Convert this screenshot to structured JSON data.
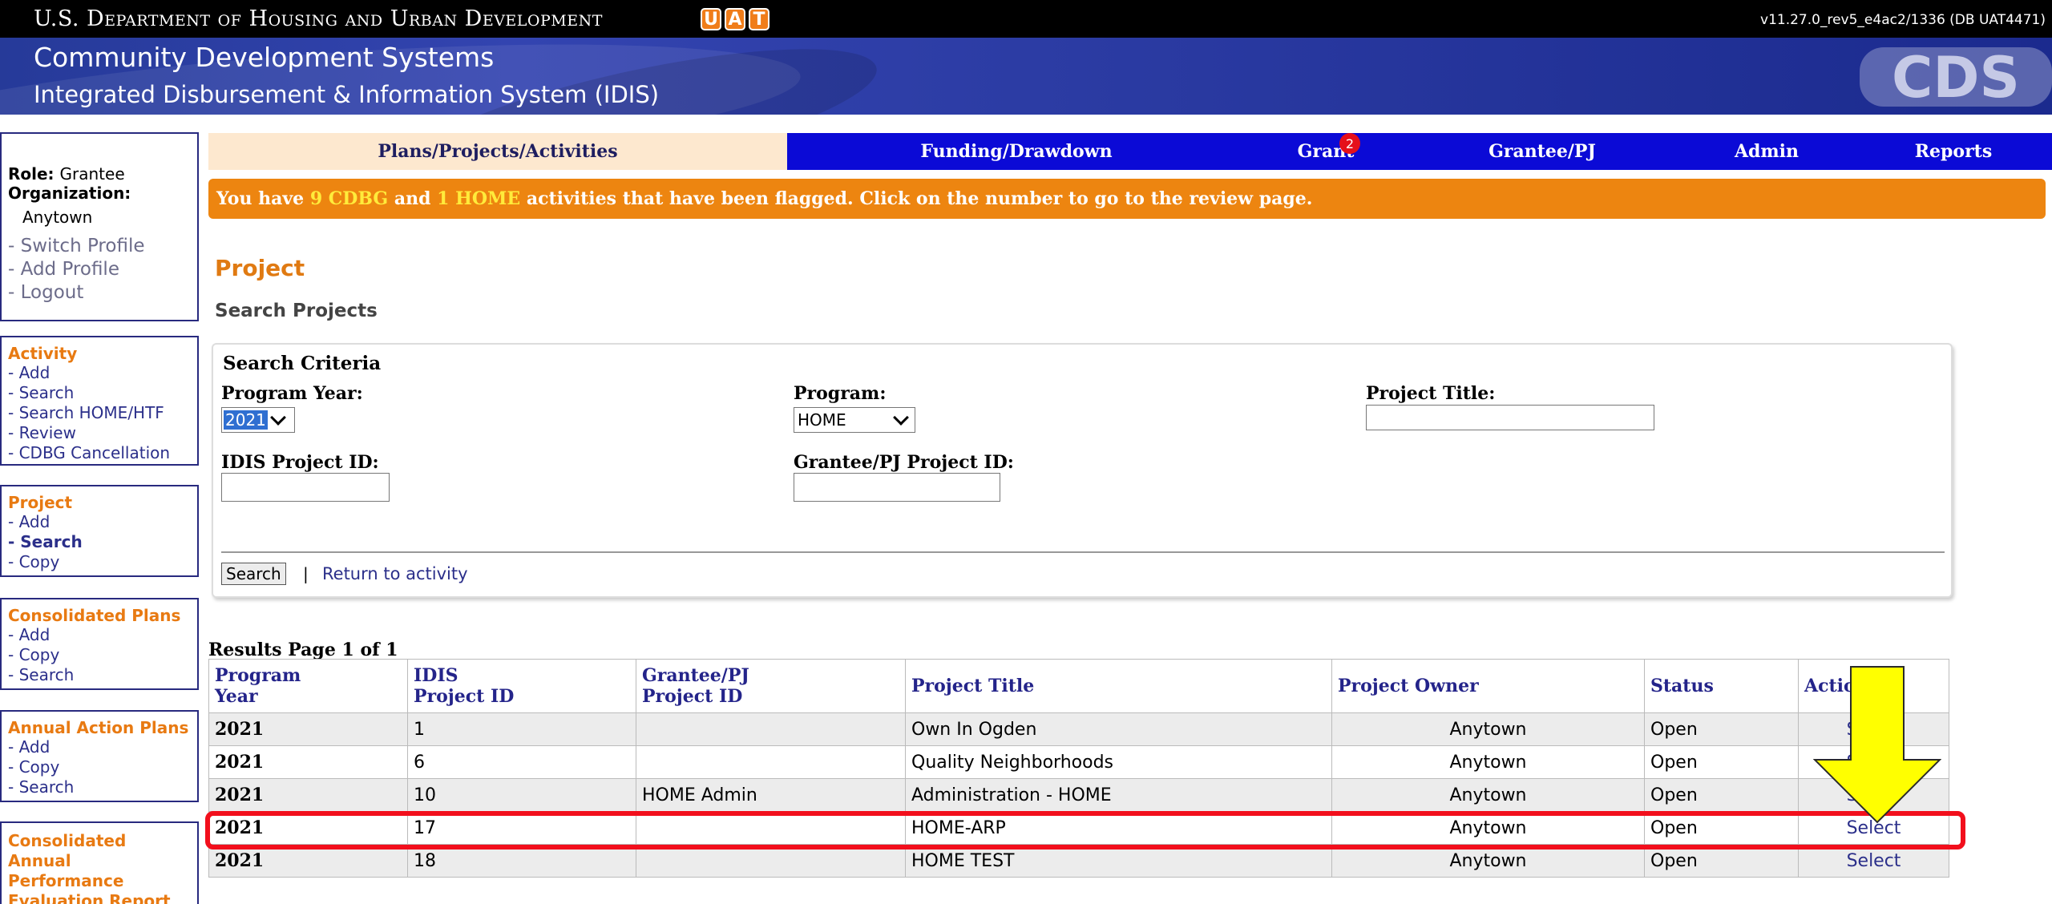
{
  "header": {
    "department": "U.S. Department of Housing and Urban Development",
    "uat_letters": [
      "U",
      "A",
      "T"
    ],
    "version": "v11.27.0_rev5_e4ac2/1336 (DB UAT4471)",
    "system_name": "Community Development Systems",
    "subsystem_name": "Integrated Disbursement & Information System (IDIS)",
    "logo_text": "CDS"
  },
  "profile": {
    "role_label": "Role:",
    "role_value": "Grantee",
    "org_label": "Organization:",
    "org_value": "Anytown",
    "links": [
      "- Switch Profile",
      "- Add Profile",
      "- Logout"
    ]
  },
  "sidebar": {
    "activity": {
      "title": "Activity",
      "links": [
        "- Add",
        "- Search",
        "- Search HOME/HTF",
        "- Review",
        "- CDBG Cancellation"
      ]
    },
    "project": {
      "title": "Project",
      "links": [
        "- Add",
        "- Search",
        "- Copy"
      ]
    },
    "consolidated_plans": {
      "title": "Consolidated Plans",
      "links": [
        "- Add",
        "- Copy",
        "- Search"
      ]
    },
    "annual_action_plans": {
      "title": "Annual Action Plans",
      "links": [
        "- Add",
        "- Copy",
        "- Search"
      ]
    },
    "caper": {
      "title_lines": [
        "Consolidated",
        "Annual",
        "Performance",
        "Evaluation Report"
      ]
    }
  },
  "tabs": [
    {
      "label": "Plans/Projects/Activities",
      "active": true
    },
    {
      "label": "Funding/Drawdown"
    },
    {
      "label": "Grant",
      "badge": "2"
    },
    {
      "label": "Grantee/PJ"
    },
    {
      "label": "Admin"
    },
    {
      "label": "Reports"
    }
  ],
  "notice": {
    "prefix": "You have ",
    "cdbg_count": "9 CDBG",
    "middle": " and ",
    "home_count": "1 HOME",
    "suffix": " activities that have been flagged. Click on the number to go to the review page."
  },
  "page": {
    "title": "Project",
    "subtitle": "Search Projects"
  },
  "criteria": {
    "title": "Search Criteria",
    "program_year_label": "Program Year:",
    "program_year_value": "2021",
    "program_label": "Program:",
    "program_value": "HOME",
    "project_title_label": "Project Title:",
    "project_title_value": "",
    "idis_id_label": "IDIS Project ID:",
    "idis_id_value": "",
    "grantee_id_label": "Grantee/PJ Project ID:",
    "grantee_id_value": "",
    "search_button": "Search",
    "separator": "|",
    "return_link": "Return to activity"
  },
  "results": {
    "label": "Results Page 1 of 1",
    "columns": [
      "Program Year",
      "IDIS Project ID",
      "Grantee/PJ Project ID",
      "Project Title",
      "Project Owner",
      "Status",
      "Action"
    ],
    "rows": [
      {
        "year": "2021",
        "idis_id": "1",
        "grantee_id": "",
        "title": "Own In Ogden",
        "owner": "Anytown",
        "status": "Open",
        "action": "Select"
      },
      {
        "year": "2021",
        "idis_id": "6",
        "grantee_id": "",
        "title": "Quality Neighborhoods",
        "owner": "Anytown",
        "status": "Open",
        "action": "Select"
      },
      {
        "year": "2021",
        "idis_id": "10",
        "grantee_id": "HOME Admin",
        "title": "Administration - HOME",
        "owner": "Anytown",
        "status": "Open",
        "action": "Select"
      },
      {
        "year": "2021",
        "idis_id": "17",
        "grantee_id": "",
        "title": "HOME-ARP",
        "owner": "Anytown",
        "status": "Open",
        "action": "Select"
      },
      {
        "year": "2021",
        "idis_id": "18",
        "grantee_id": "",
        "title": "HOME TEST",
        "owner": "Anytown",
        "status": "Open",
        "action": "Select"
      }
    ]
  },
  "colors": {
    "accent_orange": "#e87a12",
    "nav_blue": "#0b0ad6",
    "highlight_red": "#f20f1c",
    "arrow_yellow": "#ffff00"
  }
}
